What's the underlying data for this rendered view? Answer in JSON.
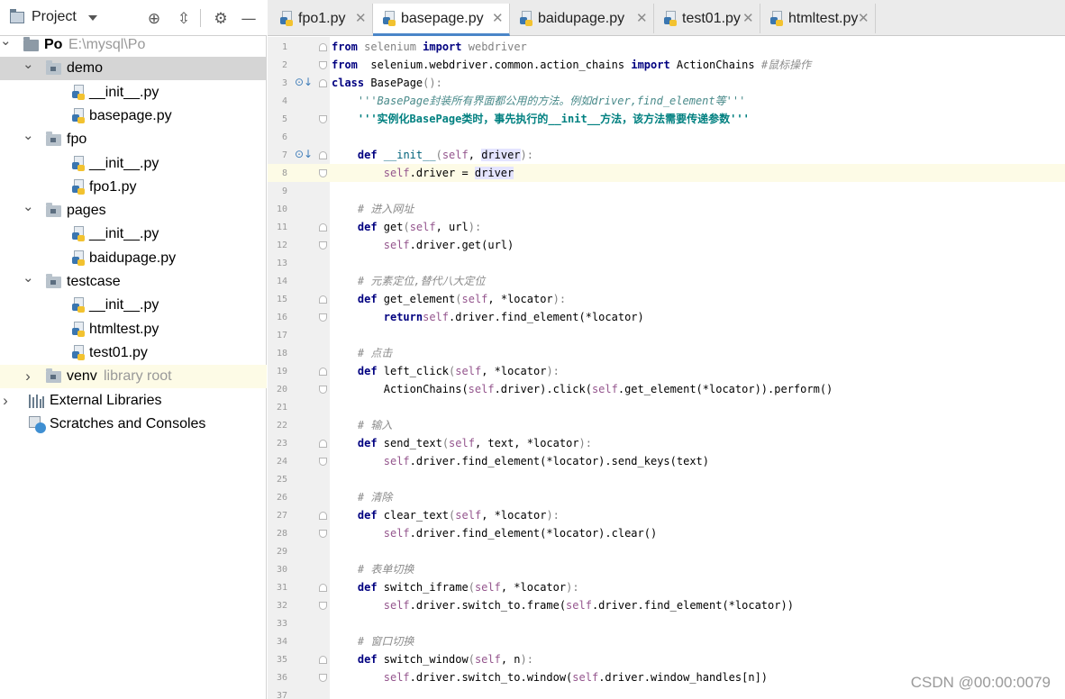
{
  "project_panel": {
    "title": "Project",
    "tree": [
      {
        "label": "Po",
        "hint": "E:\\mysql\\Po",
        "kind": "project",
        "depth": 0,
        "arrow": "down"
      },
      {
        "label": "demo",
        "kind": "folder",
        "depth": 1,
        "arrow": "down",
        "selected": true
      },
      {
        "label": "__init__.py",
        "kind": "py",
        "depth": 2
      },
      {
        "label": "basepage.py",
        "kind": "py",
        "depth": 2
      },
      {
        "label": "fpo",
        "kind": "folder",
        "depth": 1,
        "arrow": "down"
      },
      {
        "label": "__init__.py",
        "kind": "py",
        "depth": 2
      },
      {
        "label": "fpo1.py",
        "kind": "py",
        "depth": 2
      },
      {
        "label": "pages",
        "kind": "folder",
        "depth": 1,
        "arrow": "down"
      },
      {
        "label": "__init__.py",
        "kind": "py",
        "depth": 2
      },
      {
        "label": "baidupage.py",
        "kind": "py",
        "depth": 2
      },
      {
        "label": "testcase",
        "kind": "folder",
        "depth": 1,
        "arrow": "down"
      },
      {
        "label": "__init__.py",
        "kind": "py",
        "depth": 2
      },
      {
        "label": "htmltest.py",
        "kind": "py",
        "depth": 2
      },
      {
        "label": "test01.py",
        "kind": "py",
        "depth": 2
      },
      {
        "label": "venv",
        "hint": "library root",
        "kind": "folder",
        "depth": 1,
        "arrow": "right",
        "highlight": true
      },
      {
        "label": "External Libraries",
        "kind": "lib",
        "depth": 0,
        "arrow": "right"
      },
      {
        "label": "Scratches and Consoles",
        "kind": "scratch",
        "depth": 0
      }
    ]
  },
  "tabs": [
    {
      "label": "fpo1.py",
      "active": false
    },
    {
      "label": "basepage.py",
      "active": true
    },
    {
      "label": "baidupage.py",
      "active": false
    },
    {
      "label": "test01.py",
      "active": false
    },
    {
      "label": "htmltest.py",
      "active": false
    }
  ],
  "editor": {
    "current_line": 8,
    "lines": [
      {
        "n": "1",
        "indent": 0,
        "tokens": [
          [
            "kw",
            "from"
          ],
          [
            "dim2",
            " selenium "
          ],
          [
            "kw",
            "import"
          ],
          [
            "dim2",
            " webdriver"
          ]
        ]
      },
      {
        "n": "2",
        "indent": 0,
        "tokens": [
          [
            "kw",
            "from"
          ],
          [
            "",
            "  selenium.webdriver.common.action_chains "
          ],
          [
            "kw",
            "import"
          ],
          [
            "",
            " ActionChains "
          ],
          [
            "cmt",
            "#鼠标操作"
          ]
        ]
      },
      {
        "n": "3",
        "indent": 0,
        "tokens": [
          [
            "kw",
            "class"
          ],
          [
            "",
            " BasePage"
          ],
          [
            "paren",
            "():"
          ]
        ]
      },
      {
        "n": "4",
        "indent": 4,
        "tokens": [
          [
            "doc",
            "'''BasePage封装所有界面都公用的方法。例如driver,find_element等'''"
          ]
        ]
      },
      {
        "n": "5",
        "indent": 4,
        "tokens": [
          [
            "doc2",
            "'''实例化BasePage类时，事先执行的__init__方法，该方法需要传递参数'''"
          ]
        ]
      },
      {
        "n": "6",
        "indent": 0,
        "tokens": []
      },
      {
        "n": "7",
        "indent": 4,
        "tokens": [
          [
            "kw",
            "def"
          ],
          [
            "fn",
            " __init__"
          ],
          [
            "paren",
            "("
          ],
          [
            "slf",
            "self"
          ],
          [
            "",
            ", "
          ],
          [
            "hlp",
            "driver"
          ],
          [
            "paren",
            "):"
          ]
        ]
      },
      {
        "n": "8",
        "indent": 8,
        "tokens": [
          [
            "slf",
            "self"
          ],
          [
            "",
            ".driver = "
          ],
          [
            "hlp",
            "driver"
          ]
        ]
      },
      {
        "n": "9",
        "indent": 0,
        "tokens": []
      },
      {
        "n": "10",
        "indent": 4,
        "tokens": [
          [
            "cmt",
            "# 进入网址"
          ]
        ]
      },
      {
        "n": "11",
        "indent": 4,
        "tokens": [
          [
            "kw",
            "def"
          ],
          [
            "",
            " get"
          ],
          [
            "paren",
            "("
          ],
          [
            "slf",
            "self"
          ],
          [
            "",
            ", url"
          ],
          [
            "paren",
            "):"
          ]
        ]
      },
      {
        "n": "12",
        "indent": 8,
        "tokens": [
          [
            "slf",
            "self"
          ],
          [
            "",
            ".driver.get(url)"
          ]
        ]
      },
      {
        "n": "13",
        "indent": 0,
        "tokens": []
      },
      {
        "n": "14",
        "indent": 4,
        "tokens": [
          [
            "cmt",
            "# 元素定位,替代八大定位"
          ]
        ]
      },
      {
        "n": "15",
        "indent": 4,
        "tokens": [
          [
            "kw",
            "def"
          ],
          [
            "",
            " get_element"
          ],
          [
            "paren",
            "("
          ],
          [
            "slf",
            "self"
          ],
          [
            "",
            ", *locator"
          ],
          [
            "paren",
            "):"
          ]
        ]
      },
      {
        "n": "16",
        "indent": 8,
        "tokens": [
          [
            "kw",
            "return"
          ],
          [
            " ",
            ""
          ],
          [
            "slf",
            "self"
          ],
          [
            "",
            ".driver.find_element(*locator)"
          ]
        ]
      },
      {
        "n": "17",
        "indent": 0,
        "tokens": []
      },
      {
        "n": "18",
        "indent": 4,
        "tokens": [
          [
            "cmt",
            "# 点击"
          ]
        ]
      },
      {
        "n": "19",
        "indent": 4,
        "tokens": [
          [
            "kw",
            "def"
          ],
          [
            "",
            " left_click"
          ],
          [
            "paren",
            "("
          ],
          [
            "slf",
            "self"
          ],
          [
            "",
            ", *locator"
          ],
          [
            "paren",
            "):"
          ]
        ]
      },
      {
        "n": "20",
        "indent": 8,
        "tokens": [
          [
            "",
            "ActionChains("
          ],
          [
            "slf",
            "self"
          ],
          [
            "",
            ".driver).click("
          ],
          [
            "slf",
            "self"
          ],
          [
            "",
            ".get_element(*locator)).perform()"
          ]
        ]
      },
      {
        "n": "21",
        "indent": 0,
        "tokens": []
      },
      {
        "n": "22",
        "indent": 4,
        "tokens": [
          [
            "cmt",
            "# 输入"
          ]
        ]
      },
      {
        "n": "23",
        "indent": 4,
        "tokens": [
          [
            "kw",
            "def"
          ],
          [
            "",
            " send_text"
          ],
          [
            "paren",
            "("
          ],
          [
            "slf",
            "self"
          ],
          [
            "",
            ", text, *locator"
          ],
          [
            "paren",
            "):"
          ]
        ]
      },
      {
        "n": "24",
        "indent": 8,
        "tokens": [
          [
            "slf",
            "self"
          ],
          [
            "",
            ".driver.find_element(*locator).send_keys(text)"
          ]
        ]
      },
      {
        "n": "25",
        "indent": 0,
        "tokens": []
      },
      {
        "n": "26",
        "indent": 4,
        "tokens": [
          [
            "cmt",
            "# 清除"
          ]
        ]
      },
      {
        "n": "27",
        "indent": 4,
        "tokens": [
          [
            "kw",
            "def"
          ],
          [
            "",
            " clear_text"
          ],
          [
            "paren",
            "("
          ],
          [
            "slf",
            "self"
          ],
          [
            "",
            ", *locator"
          ],
          [
            "paren",
            "):"
          ]
        ]
      },
      {
        "n": "28",
        "indent": 8,
        "tokens": [
          [
            "slf",
            "self"
          ],
          [
            "",
            ".driver.find_element(*locator).clear()"
          ]
        ]
      },
      {
        "n": "29",
        "indent": 0,
        "tokens": []
      },
      {
        "n": "30",
        "indent": 4,
        "tokens": [
          [
            "cmt",
            "# 表单切换"
          ]
        ]
      },
      {
        "n": "31",
        "indent": 4,
        "tokens": [
          [
            "kw",
            "def"
          ],
          [
            "",
            " switch_iframe"
          ],
          [
            "paren",
            "("
          ],
          [
            "slf",
            "self"
          ],
          [
            "",
            ", *locator"
          ],
          [
            "paren",
            "):"
          ]
        ]
      },
      {
        "n": "32",
        "indent": 8,
        "tokens": [
          [
            "slf",
            "self"
          ],
          [
            "",
            ".driver.switch_to.frame("
          ],
          [
            "slf",
            "self"
          ],
          [
            "",
            ".driver.find_element(*locator))"
          ]
        ]
      },
      {
        "n": "33",
        "indent": 0,
        "tokens": []
      },
      {
        "n": "34",
        "indent": 4,
        "tokens": [
          [
            "cmt",
            "# 窗口切换"
          ]
        ]
      },
      {
        "n": "35",
        "indent": 4,
        "tokens": [
          [
            "kw",
            "def"
          ],
          [
            "",
            " switch_window"
          ],
          [
            "paren",
            "("
          ],
          [
            "slf",
            "self"
          ],
          [
            "",
            ", n"
          ],
          [
            "paren",
            "):"
          ]
        ]
      },
      {
        "n": "36",
        "indent": 8,
        "tokens": [
          [
            "slf",
            "self"
          ],
          [
            "",
            ".driver.switch_to.window("
          ],
          [
            "slf",
            "self"
          ],
          [
            "",
            ".driver.window_handles[n])"
          ]
        ]
      },
      {
        "n": "37",
        "indent": 0,
        "tokens": []
      }
    ]
  },
  "watermark": "CSDN @00:00:0079"
}
